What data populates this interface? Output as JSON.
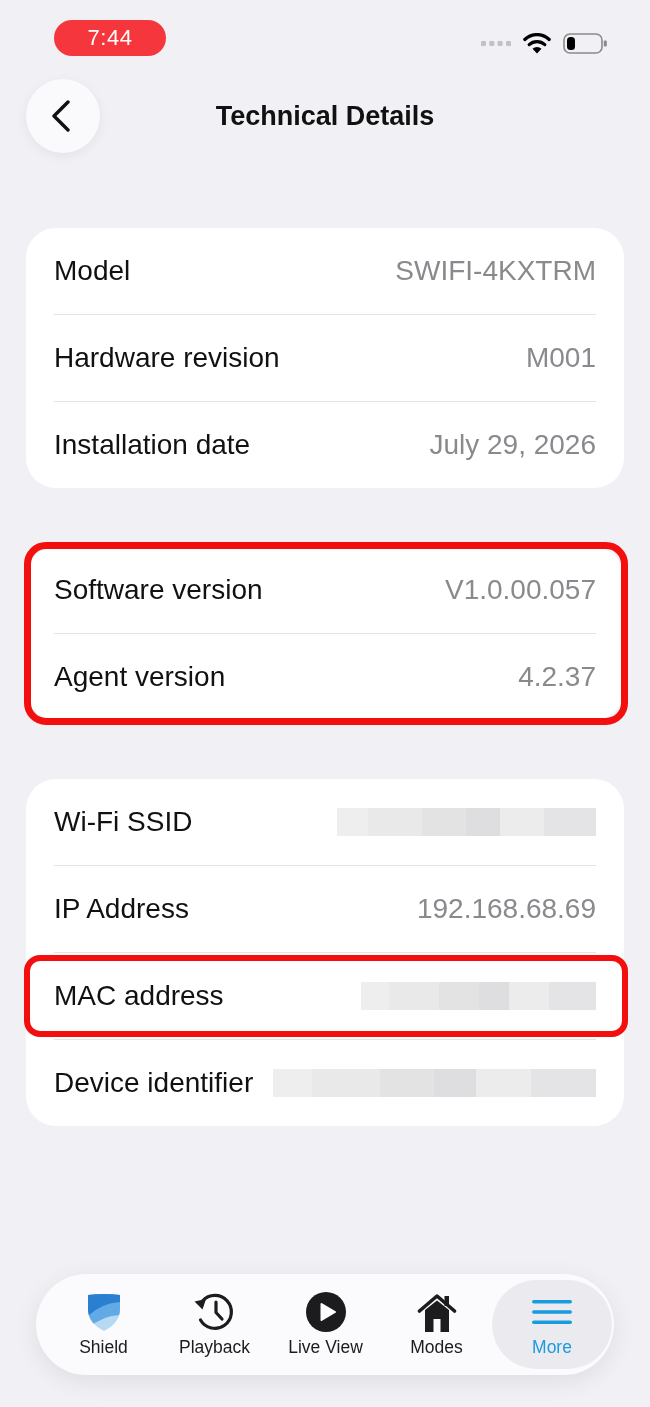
{
  "status_bar": {
    "time": "7:44"
  },
  "header": {
    "title": "Technical Details"
  },
  "sections": [
    {
      "highlighted": false,
      "rows": [
        {
          "label": "Model",
          "kind": "text",
          "value": "SWIFI-4KXTRM",
          "highlighted": false
        },
        {
          "label": "Hardware revision",
          "kind": "text",
          "value": "M001",
          "highlighted": false
        },
        {
          "label": "Installation date",
          "kind": "text",
          "value": "July 29, 2026",
          "highlighted": false
        }
      ]
    },
    {
      "highlighted": true,
      "rows": [
        {
          "label": "Software version",
          "kind": "text",
          "value": "V1.0.00.057",
          "highlighted": false
        },
        {
          "label": "Agent version",
          "kind": "text",
          "value": "4.2.37",
          "highlighted": false
        }
      ]
    },
    {
      "highlighted": false,
      "rows": [
        {
          "label": "Wi-Fi SSID",
          "kind": "redacted",
          "highlighted": false
        },
        {
          "label": "IP Address",
          "kind": "text",
          "value": "192.168.68.69",
          "highlighted": false
        },
        {
          "label": "MAC address",
          "kind": "redacted",
          "highlighted": true
        },
        {
          "label": "Device identifier",
          "kind": "redacted",
          "highlighted": false
        }
      ]
    }
  ],
  "tab_bar": {
    "tabs": [
      {
        "label": "Shield",
        "selected": false
      },
      {
        "label": "Playback",
        "selected": false
      },
      {
        "label": "Live View",
        "selected": false
      },
      {
        "label": "Modes",
        "selected": false
      },
      {
        "label": "More",
        "selected": true
      }
    ]
  }
}
